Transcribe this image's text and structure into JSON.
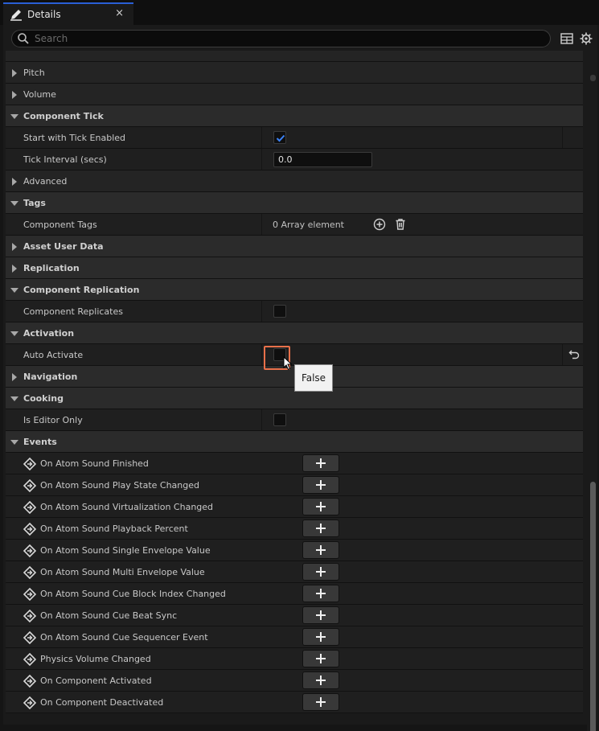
{
  "tab": {
    "title": "Details",
    "close": "×"
  },
  "search": {
    "placeholder": "Search",
    "value": ""
  },
  "toolbar": {
    "table_icon": "table-icon",
    "settings_icon": "gear-icon"
  },
  "rows": {
    "pitch": "Pitch",
    "volume": "Volume",
    "component_tick": "Component Tick",
    "start_with_tick": "Start with Tick Enabled",
    "tick_interval": "Tick Interval (secs)",
    "tick_interval_value": "0.0",
    "advanced": "Advanced",
    "tags": "Tags",
    "component_tags": "Component Tags",
    "component_tags_value": "0 Array element",
    "asset_user_data": "Asset User Data",
    "replication": "Replication",
    "component_replication": "Component Replication",
    "component_replicates": "Component Replicates",
    "activation": "Activation",
    "auto_activate": "Auto Activate",
    "navigation": "Navigation",
    "cooking": "Cooking",
    "is_editor_only": "Is Editor Only",
    "events": "Events"
  },
  "checkboxes": {
    "start_with_tick": true,
    "component_replicates": false,
    "auto_activate": false,
    "is_editor_only": false
  },
  "events": [
    "On Atom Sound Finished",
    "On Atom Sound Play State Changed",
    "On Atom Sound Virtualization Changed",
    "On Atom Sound Playback Percent",
    "On Atom Sound Single Envelope Value",
    "On Atom Sound Multi Envelope Value",
    "On Atom Sound Cue Block Index Changed",
    "On Atom Sound Cue Beat Sync",
    "On Atom Sound Cue Sequencer Event",
    "Physics Volume Changed",
    "On Component Activated",
    "On Component Deactivated"
  ],
  "tooltip": "False",
  "colors": {
    "accent": "#2a5fd6",
    "highlight": "#e8704a",
    "check": "#3b82f6"
  }
}
